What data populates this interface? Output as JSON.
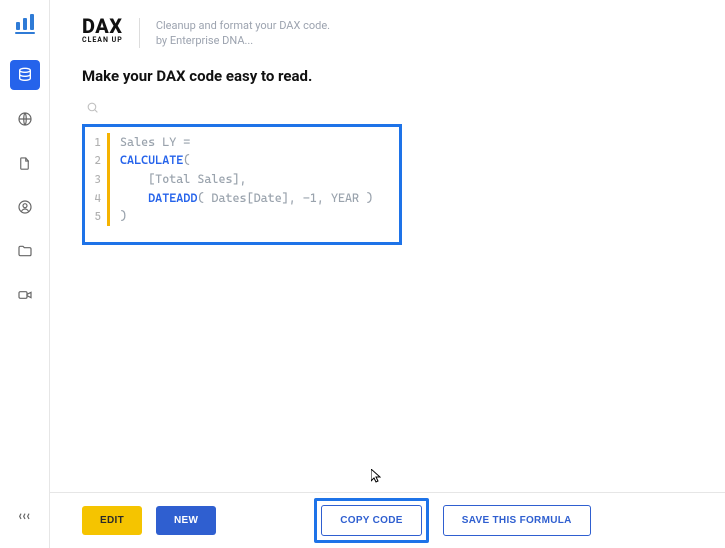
{
  "brand": {
    "main": "DAX",
    "sub": "CLEAN UP"
  },
  "tagline": {
    "line1": "Cleanup and format your DAX code.",
    "line2": "by Enterprise DNA..."
  },
  "page_title": "Make your DAX code easy to read.",
  "code": {
    "lines": [
      {
        "n": "1",
        "html": "<span class='tok-dim'>Sales LY </span><span class='tok-eq'>=</span>"
      },
      {
        "n": "2",
        "html": "<span class='tok-kw'>CALCULATE</span><span class='tok-paren'>(</span>"
      },
      {
        "n": "3",
        "html": "<span class='tok-dim'>&nbsp;&nbsp;&nbsp;&nbsp;[Total Sales],</span>"
      },
      {
        "n": "4",
        "html": "<span class='tok-dim'>&nbsp;&nbsp;&nbsp;&nbsp;</span><span class='tok-kw'>DATEADD</span><span class='tok-paren'>(</span><span class='tok-dim'> Dates[Date], </span><span class='tok-num'>-1</span><span class='tok-dim'>, YEAR </span><span class='tok-paren'>)</span>"
      },
      {
        "n": "5",
        "html": "<span class='tok-paren'>)</span>"
      }
    ]
  },
  "buttons": {
    "edit": "EDIT",
    "new": "NEW",
    "copy": "COPY CODE",
    "save": "SAVE THIS FORMULA"
  }
}
